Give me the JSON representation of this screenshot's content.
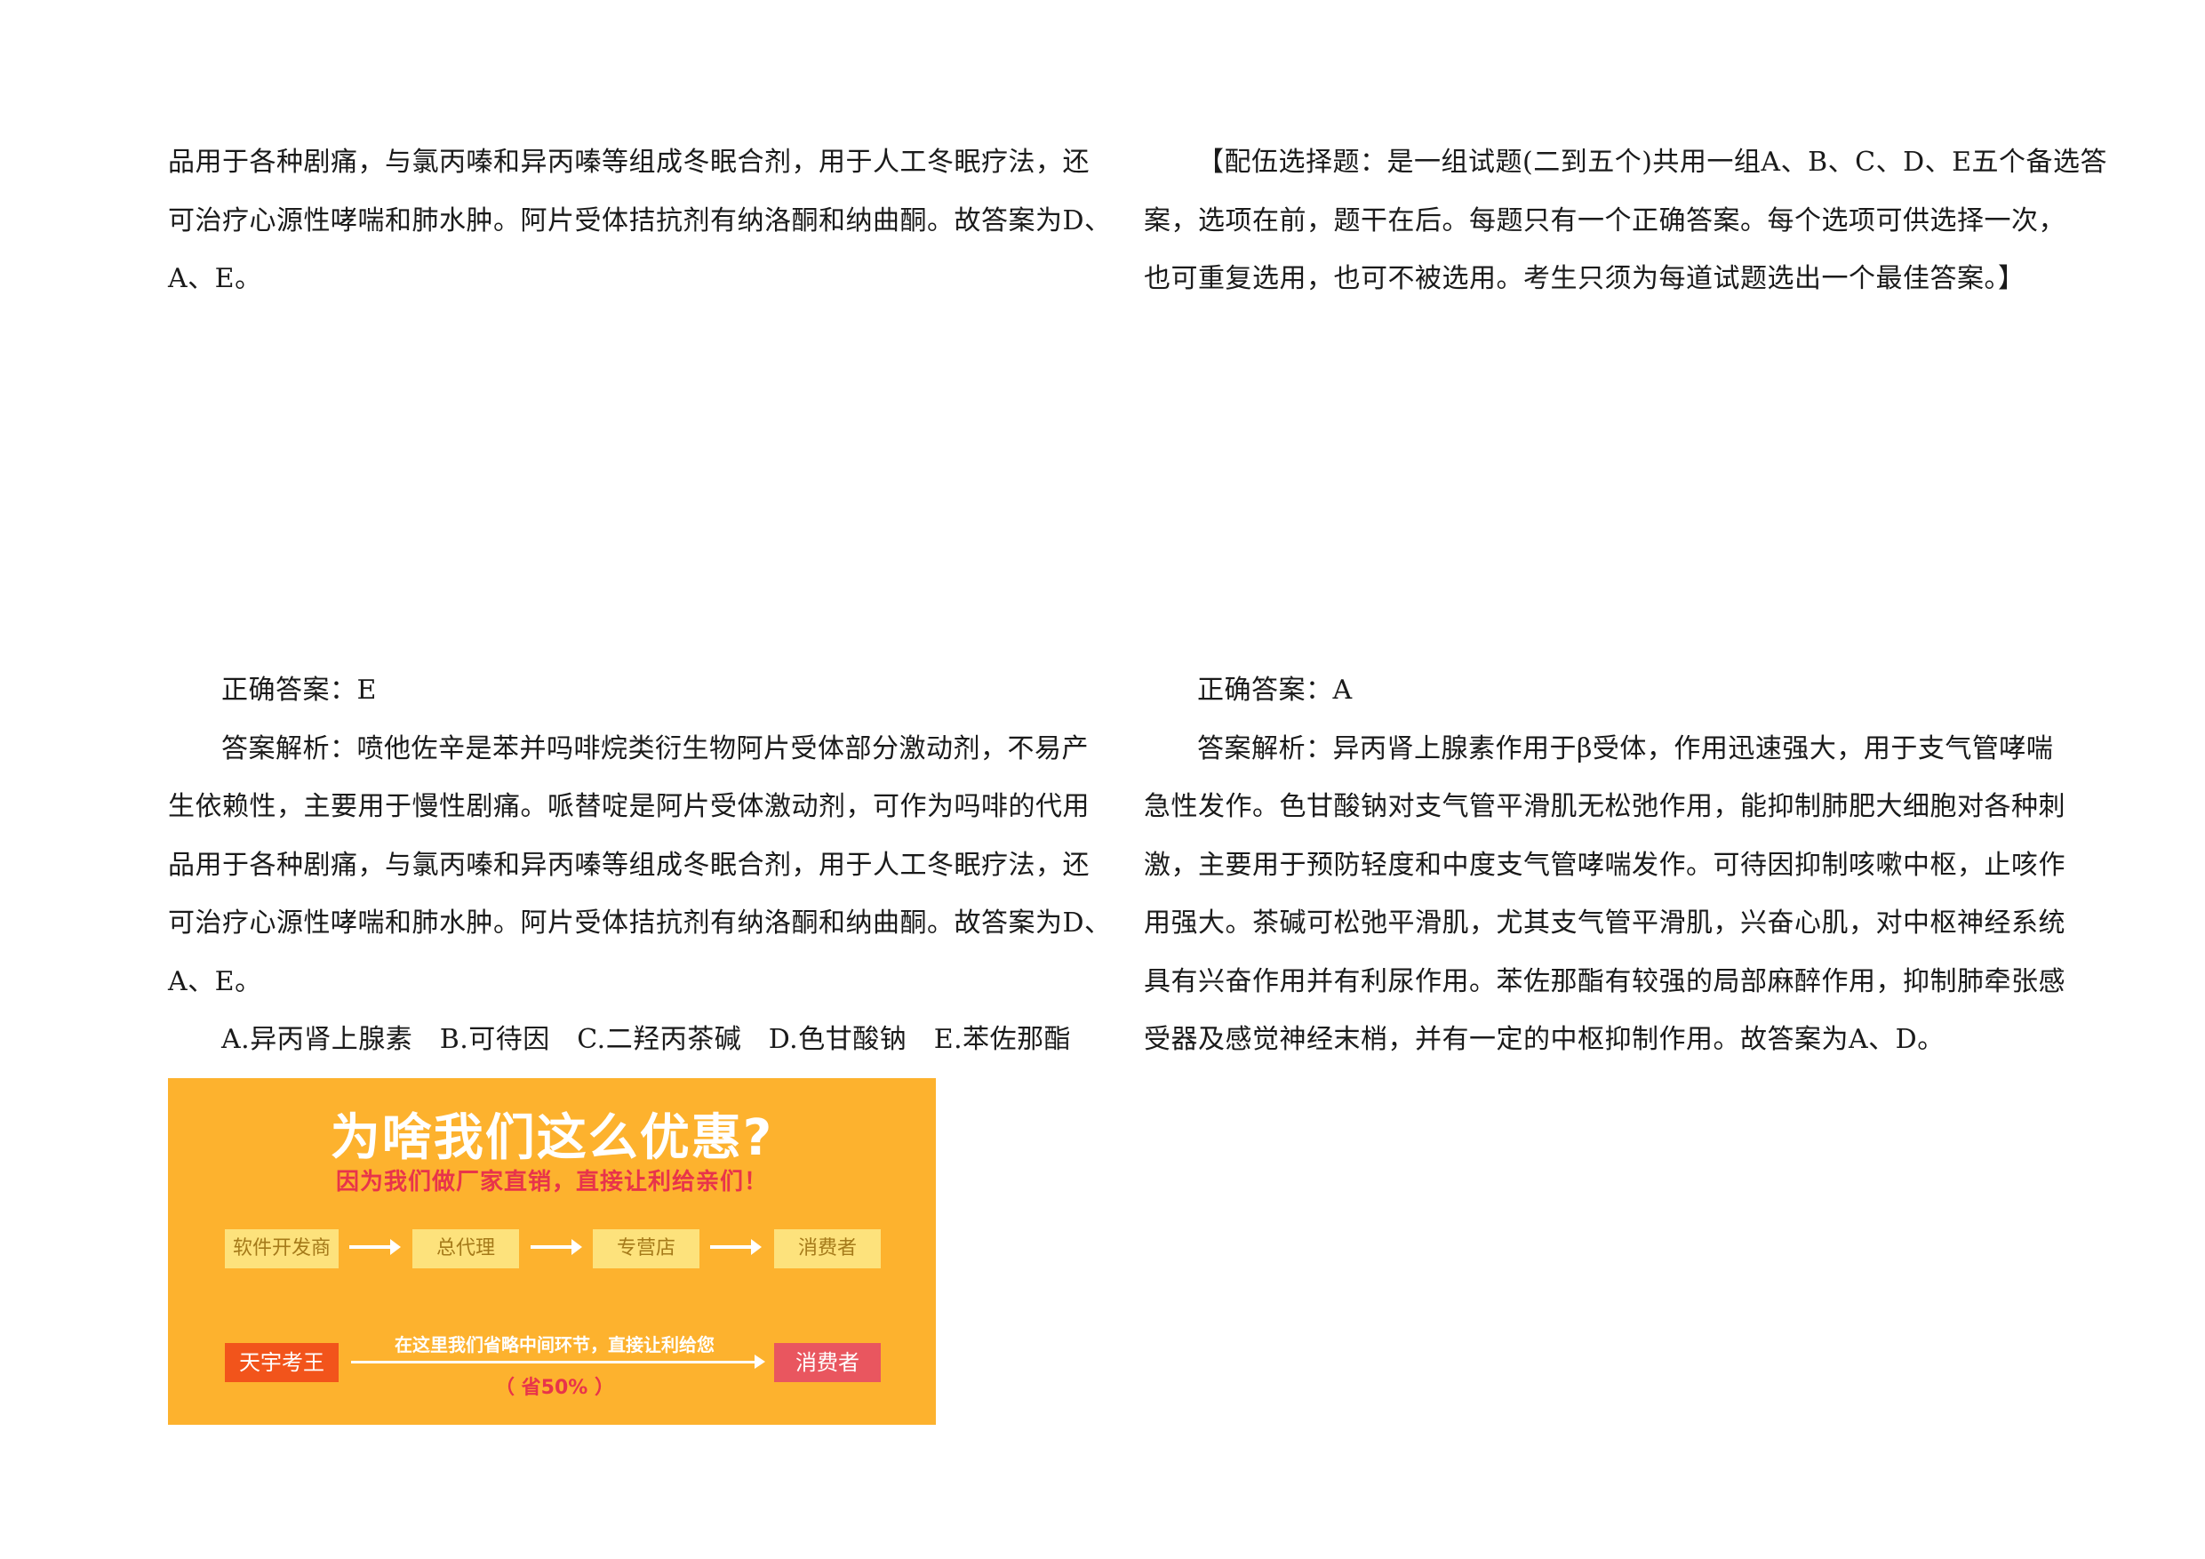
{
  "left_top": {
    "lines": [
      "品用于各种剧痛，与氯丙嗪和异丙嗪等组成冬眠合剂，用于人工冬眠疗法，还",
      "可治疗心源性哮喘和肺水肿。阿片受体拮抗剂有纳洛酮和纳曲酮。故答案为D、",
      "A、E。"
    ]
  },
  "right_top": {
    "lines": [
      "【配伍选择题：是一组试题(二到五个)共用一组A、B、C、D、E五个备选答",
      "案，选项在前，题干在后。每题只有一个正确答案。每个选项可供选择一次，",
      "也可重复选用，也可不被选用。考生只须为每道试题选出一个最佳答案。】"
    ]
  },
  "left_bottom": {
    "answer": "正确答案：E",
    "lines": [
      "答案解析：喷他佐辛是苯并吗啡烷类衍生物阿片受体部分激动剂，不易产",
      "生依赖性，主要用于慢性剧痛。哌替啶是阿片受体激动剂，可作为吗啡的代用",
      "品用于各种剧痛，与氯丙嗪和异丙嗪等组成冬眠合剂，用于人工冬眠疗法，还",
      "可治疗心源性哮喘和肺水肿。阿片受体拮抗剂有纳洛酮和纳曲酮。故答案为D、",
      "A、E。"
    ],
    "options": "A.异丙肾上腺素　B.可待因　C.二羟丙茶碱　D.色甘酸钠　E.苯佐那酯"
  },
  "right_bottom": {
    "answer": "正确答案：A",
    "lines": [
      "答案解析：异丙肾上腺素作用于β受体，作用迅速强大，用于支气管哮喘",
      "急性发作。色甘酸钠对支气管平滑肌无松弛作用，能抑制肺肥大细胞对各种刺",
      "激，主要用于预防轻度和中度支气管哮喘发作。可待因抑制咳嗽中枢，止咳作",
      "用强大。茶碱可松弛平滑肌，尤其支气管平滑肌，兴奋心肌，对中枢神经系统",
      "具有兴奋作用并有利尿作用。苯佐那酯有较强的局部麻醉作用，抑制肺牵张感",
      "受器及感觉神经末梢，并有一定的中枢抑制作用。故答案为A、D。"
    ]
  },
  "banner": {
    "title": "为啥我们这么优惠?",
    "subtitle": "因为我们做厂家直销，直接让利给亲们！",
    "flow": [
      "软件开发商",
      "总代理",
      "专营店",
      "消费者"
    ],
    "brand": "天宇考王",
    "arrow_text": "在这里我们省略中间环节，直接让利给您",
    "save_text": "（ 省50% ）",
    "consumer": "消费者",
    "colors": {
      "background": "#fdb22e",
      "flow_box": "#fde27c",
      "brand_box": "#f2541b",
      "consumer_box": "#e9565f",
      "accent_text": "#e8344a"
    }
  }
}
